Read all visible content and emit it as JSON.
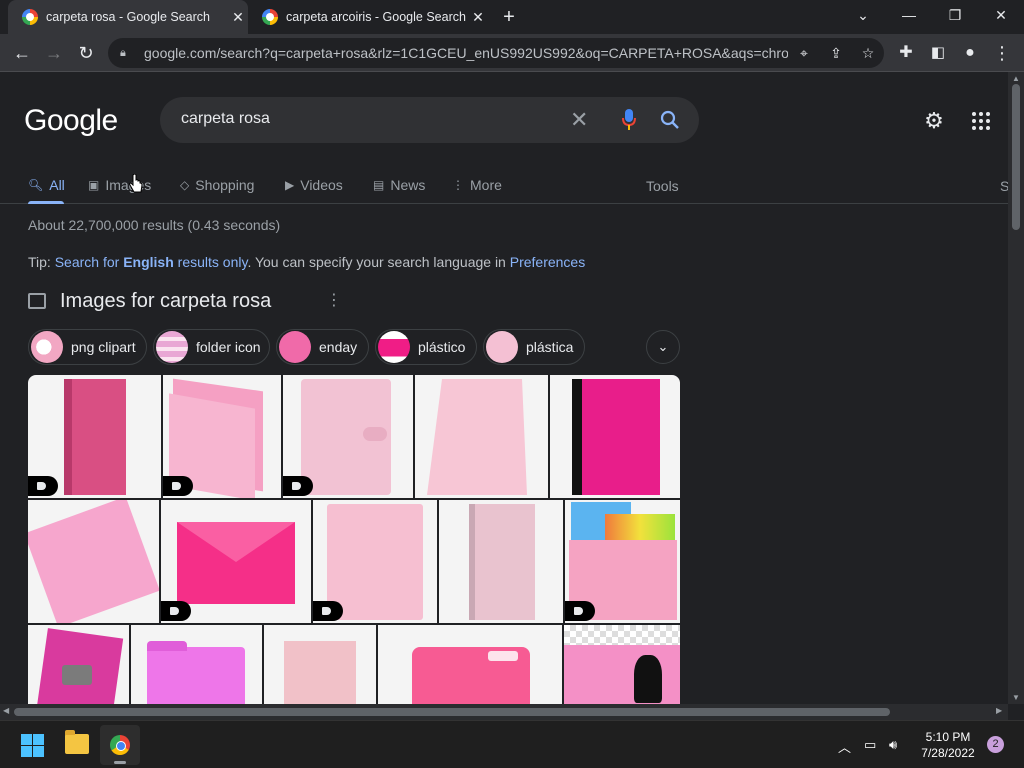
{
  "browser": {
    "tabs": [
      {
        "title": "carpeta rosa - Google Search",
        "active": true
      },
      {
        "title": "carpeta arcoiris - Google Search",
        "active": false
      }
    ],
    "url": "google.com/search?q=carpeta+rosa&rlz=1C1GCEU_enUS992US992&oq=CARPETA+ROSA&aqs=chro...",
    "window_controls": [
      "chevron-down-icon",
      "minimize-icon",
      "restore-icon",
      "close-icon"
    ]
  },
  "search": {
    "logo": "Google",
    "query": "carpeta rosa"
  },
  "nav": {
    "tabs": [
      {
        "label": "All",
        "icon": "search-icon",
        "selected": true
      },
      {
        "label": "Images",
        "icon": "image-icon"
      },
      {
        "label": "Shopping",
        "icon": "tag-icon"
      },
      {
        "label": "Videos",
        "icon": "play-icon"
      },
      {
        "label": "News",
        "icon": "news-icon"
      },
      {
        "label": "More",
        "icon": "more-vert-icon"
      }
    ],
    "tools": "Tools",
    "edge_text": "S"
  },
  "results": {
    "stats": "About 22,700,000 results (0.43 seconds)",
    "tip_prefix": "Tip: ",
    "tip_link_pre": "Search for ",
    "tip_link_bold": "English",
    "tip_link_post": " results only",
    "tip_middle": ". You can specify your search language in ",
    "tip_pref": "Preferences"
  },
  "images": {
    "heading": "Images for carpeta rosa",
    "chips": [
      {
        "label": "png clipart",
        "color": "#f2a7c3"
      },
      {
        "label": "folder icon",
        "color": "#e9a7d4"
      },
      {
        "label": "enday",
        "color": "#f06aa9"
      },
      {
        "label": "plástico",
        "color": "#f01d86"
      },
      {
        "label": "plástica",
        "color": "#f4c0d3"
      }
    ],
    "tiles": [
      {
        "color": "#d94f83",
        "tag": true
      },
      {
        "color": "#f5a0c3",
        "tag": true
      },
      {
        "color": "#f2c2d3",
        "tag": true
      },
      {
        "color": "#f7c6d5",
        "tag": false
      },
      {
        "color": "#e81e8a",
        "tag": false
      },
      {
        "color": "#f6a6cd",
        "tag": false
      },
      {
        "color": "#f52f88",
        "tag": true
      },
      {
        "color": "#f6bfd1",
        "tag": true
      },
      {
        "color": "#e9c3cf",
        "tag": false
      },
      {
        "color": "#f5a3c2",
        "tag": true
      },
      {
        "color": "#d93a9e",
        "tag": false
      },
      {
        "color": "#ee76e9",
        "tag": false
      },
      {
        "color": "#f1c1c8",
        "tag": false
      },
      {
        "color": "#f75b93",
        "tag": false
      },
      {
        "color": "#f490c6",
        "tag": false
      }
    ]
  },
  "taskbar": {
    "time": "5:10 PM",
    "date": "7/28/2022",
    "notifications": "2"
  }
}
